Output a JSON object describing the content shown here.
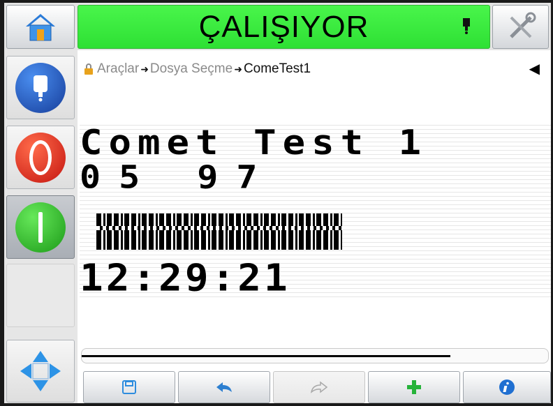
{
  "status": {
    "text": "ÇALIŞIYOR",
    "color": "#3be83f"
  },
  "breadcrumb": {
    "items": [
      "Araçlar",
      "Dosya Seçme",
      "ComeTest1"
    ],
    "lock_icon": "lock-icon",
    "back_icon": "left-triangle-icon"
  },
  "message": {
    "lines": [
      "Comet Test 1",
      "05 97",
      "12:29:21"
    ]
  },
  "icons": {
    "home": "home-icon",
    "tools": "tools-icon",
    "ink": "ink-cartridge-icon",
    "stop": "stop-icon",
    "start": "start-icon",
    "nav": "move-arrows-icon",
    "save": "save-icon",
    "undo": "undo-icon",
    "redo": "redo-icon",
    "add": "add-icon",
    "info": "info-icon"
  },
  "scroll": {
    "position": 0.79
  }
}
